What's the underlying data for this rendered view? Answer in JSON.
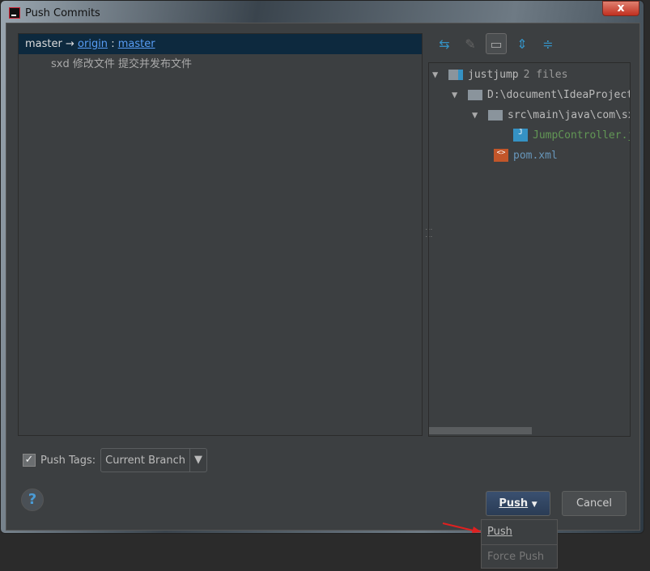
{
  "window": {
    "title": "Push Commits",
    "close_label": "x"
  },
  "commits": {
    "branch_local": "master",
    "arrow": "→",
    "remote": "origin",
    "separator": ":",
    "branch_remote": "master",
    "commit_message": "sxd 修改文件 提交并发布文件"
  },
  "toolbar": {
    "icons": [
      "collapse-icon",
      "edit-source-icon",
      "group-by-directory-icon",
      "expand-all-icon",
      "collapse-all-icon"
    ]
  },
  "tree": {
    "root": "justjump",
    "root_count": "2 files",
    "dir1": "D:\\document\\IdeaProject",
    "dir2": "src\\main\\java\\com\\sx",
    "file1": "JumpController.java",
    "file2": "pom.xml"
  },
  "footer": {
    "push_tags_label": "Push Tags:",
    "push_tags_checked": true,
    "tags_value": "Current Branch",
    "help": "?",
    "push_button": "Push",
    "cancel_button": "Cancel"
  },
  "menu": {
    "items": [
      "Push",
      "Force Push"
    ]
  },
  "colors": {
    "accent": "#589df6",
    "selection": "#0d293e",
    "file_modified": "#629755",
    "file_new": "#6897bb"
  }
}
